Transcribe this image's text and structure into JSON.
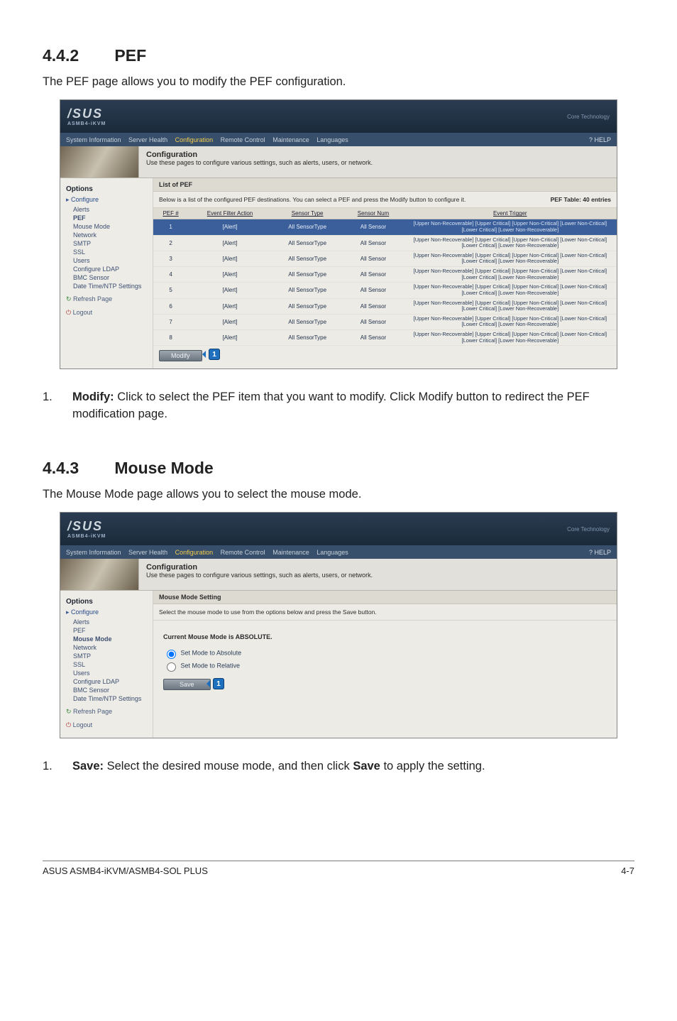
{
  "sections": {
    "pef": {
      "number": "4.4.2",
      "title": "PEF",
      "intro": "The PEF page allows you to modify the PEF configuration.",
      "step1_label": "1.",
      "step1_bold": "Modify:",
      "step1_rest": " Click to select the PEF item that you want to modify. Click Modify button to redirect the PEF modification page."
    },
    "mouse": {
      "number": "4.4.3",
      "title": "Mouse Mode",
      "intro": "The Mouse Mode page allows you to select the mouse mode.",
      "step1_label": "1.",
      "step1_bold": "Save:",
      "step1_mid": " Select the desired mouse mode, and then click ",
      "step1_bold2": "Save",
      "step1_tail": " to apply the setting."
    }
  },
  "ui": {
    "brand": "/SUS",
    "brand_sub": "ASMB4-iKVM",
    "slogan": "Core Technology",
    "tabs": [
      "System Information",
      "Server Health",
      "Configuration",
      "Remote Control",
      "Maintenance",
      "Languages"
    ],
    "help": "? HELP",
    "conf_title": "Configuration",
    "conf_desc": "Use these pages to configure various settings, such as alerts, users, or network.",
    "sidebar": {
      "header": "Options",
      "group": "Configure",
      "items_pef": [
        "Alerts",
        "PEF",
        "Mouse Mode",
        "Network",
        "SMTP",
        "SSL",
        "Users",
        "Configure LDAP",
        "BMC Sensor",
        "Date Time/NTP Settings"
      ],
      "active_pef": "PEF",
      "active_mouse": "Mouse Mode",
      "refresh": "Refresh Page",
      "logout": "Logout"
    },
    "pef_panel": {
      "list_hdr": "List of PEF",
      "substrip": "Below is a list of the configured PEF destinations. You can select a PEF and press the Modify button to configure it.",
      "count": "PEF Table: 40 entries",
      "cols": [
        "PEF #",
        "Event Filter Action",
        "Sensor Type",
        "Sensor Num",
        "Event Trigger"
      ],
      "rows": [
        {
          "n": "1",
          "a": "[Alert]",
          "t": "All SensorType",
          "s": "All Sensor",
          "e": "[Upper Non-Recoverable] [Upper Critical] [Upper Non-Critical] [Lower Non-Critical] [Lower Critical] [Lower Non-Recoverable]"
        },
        {
          "n": "2",
          "a": "[Alert]",
          "t": "All SensorType",
          "s": "All Sensor",
          "e": "[Upper Non-Recoverable] [Upper Critical] [Upper Non-Critical] [Lower Non-Critical] [Lower Critical] [Lower Non-Recoverable]"
        },
        {
          "n": "3",
          "a": "[Alert]",
          "t": "All SensorType",
          "s": "All Sensor",
          "e": "[Upper Non-Recoverable] [Upper Critical] [Upper Non-Critical] [Lower Non-Critical] [Lower Critical] [Lower Non-Recoverable]"
        },
        {
          "n": "4",
          "a": "[Alert]",
          "t": "All SensorType",
          "s": "All Sensor",
          "e": "[Upper Non-Recoverable] [Upper Critical] [Upper Non-Critical] [Lower Non-Critical] [Lower Critical] [Lower Non-Recoverable]"
        },
        {
          "n": "5",
          "a": "[Alert]",
          "t": "All SensorType",
          "s": "All Sensor",
          "e": "[Upper Non-Recoverable] [Upper Critical] [Upper Non-Critical] [Lower Non-Critical] [Lower Critical] [Lower Non-Recoverable]"
        },
        {
          "n": "6",
          "a": "[Alert]",
          "t": "All SensorType",
          "s": "All Sensor",
          "e": "[Upper Non-Recoverable] [Upper Critical] [Upper Non-Critical] [Lower Non-Critical] [Lower Critical] [Lower Non-Recoverable]"
        },
        {
          "n": "7",
          "a": "[Alert]",
          "t": "All SensorType",
          "s": "All Sensor",
          "e": "[Upper Non-Recoverable] [Upper Critical] [Upper Non-Critical] [Lower Non-Critical] [Lower Critical] [Lower Non-Recoverable]"
        },
        {
          "n": "8",
          "a": "[Alert]",
          "t": "All SensorType",
          "s": "All Sensor",
          "e": "[Upper Non-Recoverable] [Upper Critical] [Upper Non-Critical] [Lower Non-Critical] [Lower Critical] [Lower Non-Recoverable]"
        }
      ],
      "modify_btn": "Modify",
      "callout": "1"
    },
    "mouse_panel": {
      "hdr": "Mouse Mode Setting",
      "substrip": "Select the mouse mode to use from the options below and press the Save button.",
      "current": "Current Mouse Mode is ABSOLUTE.",
      "opt_abs": "Set Mode to Absolute",
      "opt_rel": "Set Mode to Relative",
      "save_btn": "Save",
      "callout": "1"
    }
  },
  "footer": {
    "left": "ASUS ASMB4-iKVM/ASMB4-SOL PLUS",
    "right": "4-7"
  }
}
